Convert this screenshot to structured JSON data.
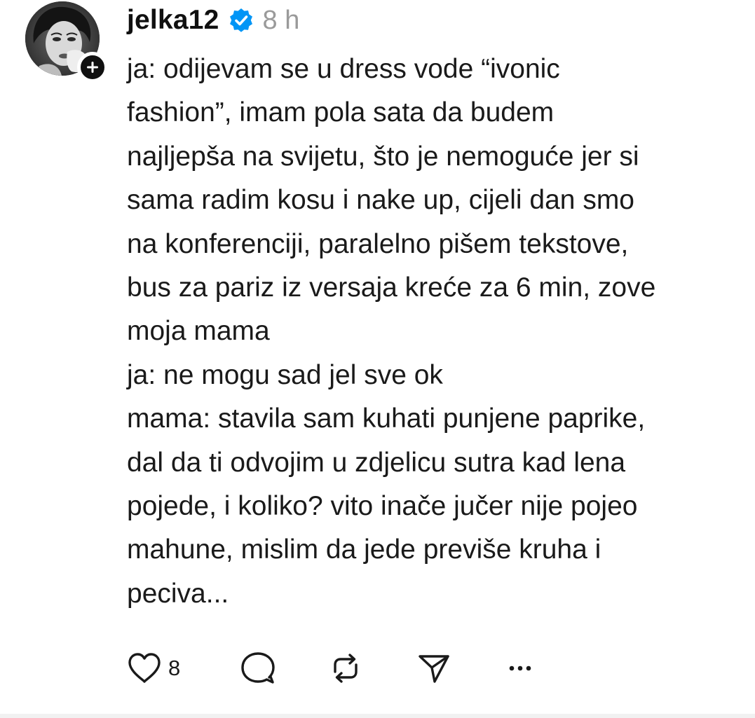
{
  "post": {
    "author": {
      "username": "jelka12",
      "verified_icon": "verified-badge-icon",
      "avatar_icon": "avatar-photo",
      "follow_icon": "plus-icon"
    },
    "time": "8 h",
    "lines": [
      "ja: odijevam se u dress vode “ivonic",
      "fashion”, imam pola sata da budem",
      "najljepša na svijetu, što je nemoguće jer si",
      "sama radim kosu i nake up, cijeli dan smo",
      "na konferenciji, paralelno pišem tekstove,",
      "bus za pariz iz versaja kreće za 6 min, zove",
      "moja mama",
      "ja: ne mogu sad jel sve ok",
      "mama: stavila sam kuhati punjene paprike,",
      "dal da ti odvojim u zdjelicu sutra kad lena",
      "pojede, i koliko? vito inače jučer nije pojeo",
      "mahune, mislim da jede previše kruha i",
      "peciva..."
    ],
    "actions": {
      "like_icon": "heart-icon",
      "like_count": "8",
      "comment_icon": "comment-bubble-icon",
      "repost_icon": "repost-icon",
      "share_icon": "send-icon",
      "more_icon": "more-dots-icon"
    },
    "colors": {
      "verified_blue": "#0095f6",
      "text": "#101010",
      "muted": "#9a9a9a"
    }
  }
}
